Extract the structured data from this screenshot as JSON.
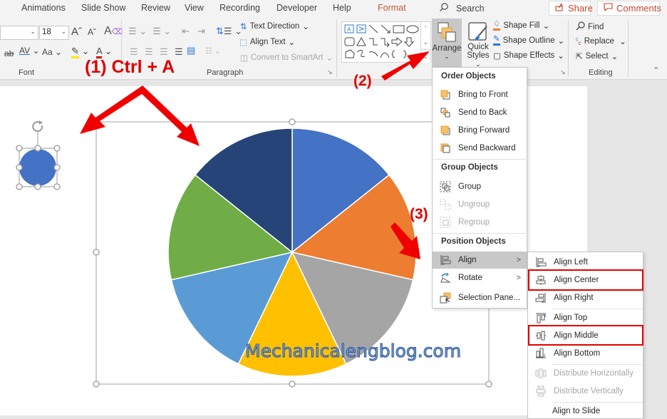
{
  "tabs": [
    {
      "label": "Animations"
    },
    {
      "label": "Slide Show"
    },
    {
      "label": "Review"
    },
    {
      "label": "View"
    },
    {
      "label": "Recording"
    },
    {
      "label": "Developer"
    },
    {
      "label": "Help"
    },
    {
      "label": "Format",
      "active": true
    }
  ],
  "search": {
    "label": "Search",
    "icon": "search-icon"
  },
  "share_button": {
    "label": "Share",
    "icon": "share-icon"
  },
  "comments_button": {
    "label": "Comments",
    "icon": "comment-icon"
  },
  "ribbon": {
    "font": {
      "group_label": "Font",
      "font_size": "18",
      "increase_font_icon": "Aˆ",
      "decrease_font_icon": "Aˇ",
      "change_case_label": "Aa"
    },
    "paragraph": {
      "group_label": "Paragraph",
      "text_direction": "Text Direction",
      "align_text": "Align Text",
      "convert_smartart": "Convert to SmartArt"
    },
    "drawing": {
      "shape_fill": "Shape Fill",
      "shape_outline": "Shape Outline",
      "shape_effects": "Shape Effects",
      "arrange": "Arrange",
      "quick_styles_1": "Quick",
      "quick_styles_2": "Styles"
    },
    "editing": {
      "group_label": "Editing",
      "find": "Find",
      "replace": "Replace",
      "select": "Select"
    }
  },
  "arrange_menu": {
    "sections": [
      {
        "header": "Order Objects",
        "items": [
          {
            "label": "Bring to Front",
            "icon": "bring-to-front-icon"
          },
          {
            "label": "Send to Back",
            "icon": "send-to-back-icon"
          },
          {
            "label": "Bring Forward",
            "icon": "bring-forward-icon"
          },
          {
            "label": "Send Backward",
            "icon": "send-backward-icon"
          }
        ]
      },
      {
        "header": "Group Objects",
        "items": [
          {
            "label": "Group",
            "icon": "group-icon"
          },
          {
            "label": "Ungroup",
            "icon": "ungroup-icon",
            "disabled": true
          },
          {
            "label": "Regroup",
            "icon": "regroup-icon",
            "disabled": true
          }
        ]
      },
      {
        "header": "Position Objects",
        "items": [
          {
            "label": "Align",
            "icon": "align-icon",
            "submenu": true,
            "highlighted": true
          },
          {
            "label": "Rotate",
            "icon": "rotate-icon",
            "submenu": true
          },
          {
            "label": "Selection Pane...",
            "icon": "selection-pane-icon"
          }
        ]
      }
    ]
  },
  "align_submenu": {
    "items": [
      {
        "label": "Align Left",
        "icon": "align-left-icon"
      },
      {
        "label": "Align Center",
        "icon": "align-center-icon",
        "boxed": true
      },
      {
        "label": "Align Right",
        "icon": "align-right-icon"
      },
      {
        "label": "Align Top",
        "icon": "align-top-icon"
      },
      {
        "label": "Align Middle",
        "icon": "align-middle-icon",
        "boxed": true
      },
      {
        "label": "Align Bottom",
        "icon": "align-bottom-icon"
      },
      {
        "label": "Distribute Horizontally",
        "icon": "distribute-horizontally-icon",
        "disabled": true
      },
      {
        "label": "Distribute Vertically",
        "icon": "distribute-vertically-icon",
        "disabled": true
      },
      {
        "label": "Align to Slide",
        "icon": ""
      }
    ]
  },
  "annotations": {
    "step1": "(1) Ctrl + A",
    "step2": "(2)",
    "step3": "(3)"
  },
  "watermark": "Mechanicalengblog.com",
  "slide": {
    "pie_slices": [
      {
        "color": "#4472c4"
      },
      {
        "color": "#ed7d31"
      },
      {
        "color": "#a5a5a5"
      },
      {
        "color": "#ffc000"
      },
      {
        "color": "#5b9bd5"
      },
      {
        "color": "#70ad47"
      },
      {
        "color": "#264478"
      }
    ],
    "small_circle_color": "#4472c4"
  },
  "colors": {
    "accent_red": "#e00000",
    "format_tab": "#c55a3a"
  }
}
